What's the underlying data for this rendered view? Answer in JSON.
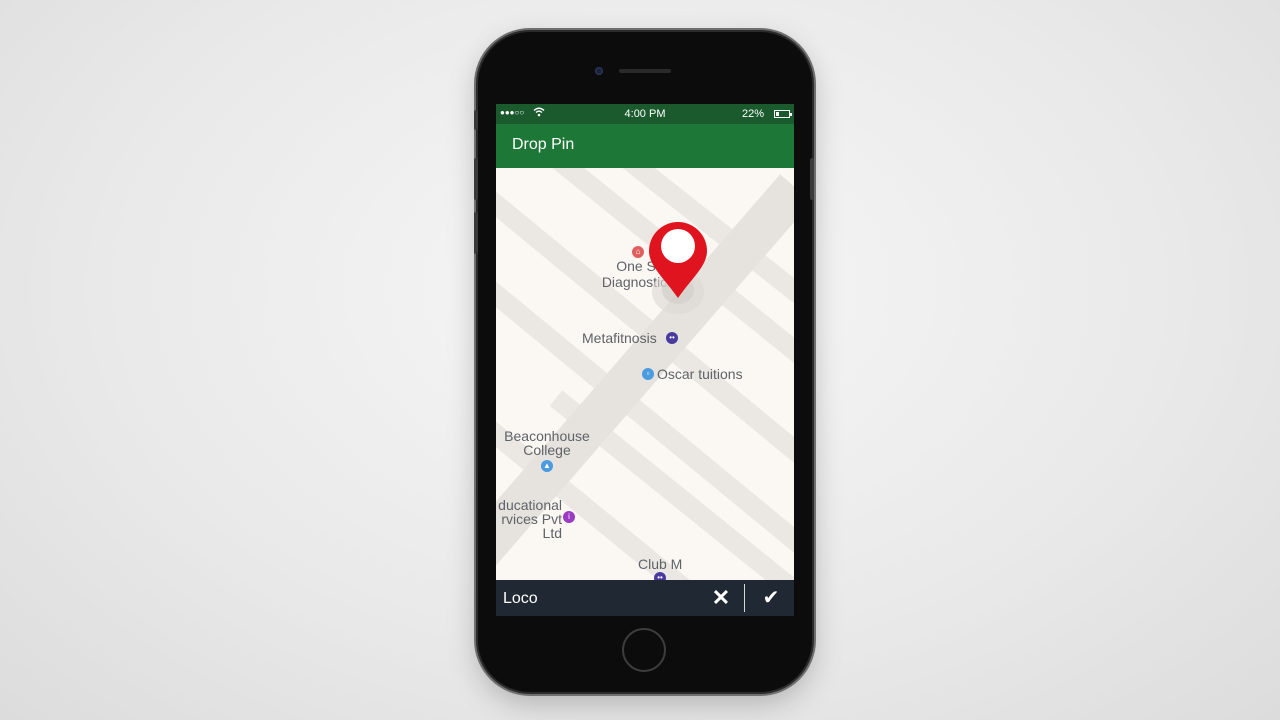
{
  "status_bar": {
    "signal": "●●●○○",
    "time": "4:00 PM",
    "battery": "22%",
    "battery_level": 0.22
  },
  "app_bar": {
    "title": "Drop Pin"
  },
  "map": {
    "places": [
      {
        "name": "One Stop\nDiagnostics",
        "line1": "One St",
        "line2": "Diagnostics"
      },
      {
        "name": "Metafitnosis"
      },
      {
        "name": "Oscar tuitions"
      },
      {
        "line1": "Beaconhouse",
        "line2": "College"
      },
      {
        "line1": "ducational",
        "line2": "rvices Pvt",
        "line3": "Ltd"
      },
      {
        "name": "Club M"
      }
    ],
    "poi_icons": [
      "hospital-icon",
      "fitness-icon",
      "school-icon",
      "graduation-cap-icon",
      "info-icon",
      "club-icon"
    ],
    "pin_color": "#e0141e"
  },
  "bottom_bar": {
    "location_text": "Loco",
    "close_icon": "close-icon",
    "confirm_icon": "check-icon"
  },
  "colors": {
    "status_bar": "#1a5a2c",
    "app_bar": "#1d7737",
    "bottom_bar": "#1f2833"
  }
}
